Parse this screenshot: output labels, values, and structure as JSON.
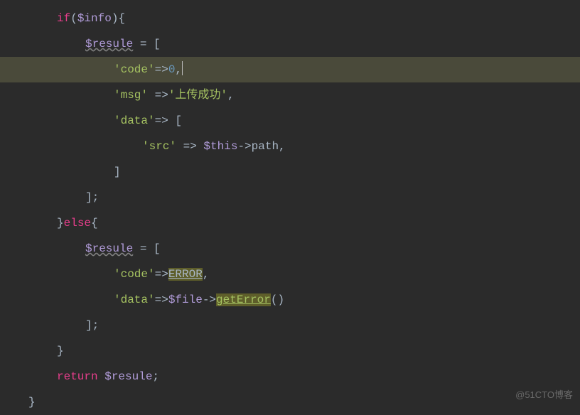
{
  "lines": {
    "l0_if": "if",
    "l0_var": "$info",
    "l0_open": "(",
    "l0_close": "){",
    "l1_var": "$resule",
    "l1_eq": " = [",
    "l2_key": "'code'",
    "l2_arrow": "=>",
    "l2_val": "0",
    "l2_comma": ",",
    "l3_key": "'msg'",
    "l3_arrow": " =>",
    "l3_val": "'上传成功'",
    "l3_comma": ",",
    "l4_key": "'data'",
    "l4_arrow": "=>",
    "l4_open": " [",
    "l5_key": "'src'",
    "l5_arrow": " => ",
    "l5_this": "$this",
    "l5_acc": "->",
    "l5_prop": "path",
    "l5_comma": ",",
    "l6_close": "]",
    "l7_close": "];",
    "l8_close": "}",
    "l8_else": "else",
    "l8_open": "{",
    "l9_var": "$resule",
    "l9_eq": " = [",
    "l10_key": "'code'",
    "l10_arrow": "=>",
    "l10_const": "ERROR",
    "l10_comma": ",",
    "l11_key": "'data'",
    "l11_arrow": "=>",
    "l11_var": "$file",
    "l11_acc": "->",
    "l11_method": "getError",
    "l11_call": "()",
    "l12_close": "];",
    "l13_close": "}",
    "l14_return": "return",
    "l14_var": " $resule",
    "l14_semi": ";",
    "l15_close": "}"
  },
  "watermark": "@51CTO博客"
}
